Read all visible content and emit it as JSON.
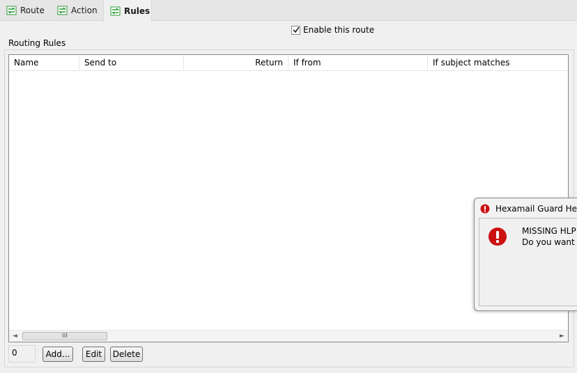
{
  "tabs": [
    {
      "label": "Route",
      "icon": "route-icon",
      "active": false
    },
    {
      "label": "Action",
      "icon": "route-icon",
      "active": false
    },
    {
      "label": "Rules",
      "icon": "route-icon",
      "active": true
    }
  ],
  "enable_route": {
    "label": "Enable this route",
    "checked": true
  },
  "routing_rules": {
    "group_label": "Routing Rules",
    "columns": [
      "Name",
      "Send to",
      "",
      "Return",
      "If from",
      "If subject matches"
    ],
    "rows": [],
    "count": "0"
  },
  "buttons": {
    "add": "Add...",
    "edit": "Edit",
    "delete": "Delete"
  },
  "scrollbar": {
    "left_arrow": "◄",
    "right_arrow": "►",
    "grip": "III"
  },
  "dialog": {
    "title": "Hexamail Guard Help",
    "message_line1": "MISSING HLP F",
    "message_line2": "Do you want to"
  },
  "colors": {
    "error_red": "#cc1111",
    "tab_icon_green": "#2e9b3a"
  }
}
